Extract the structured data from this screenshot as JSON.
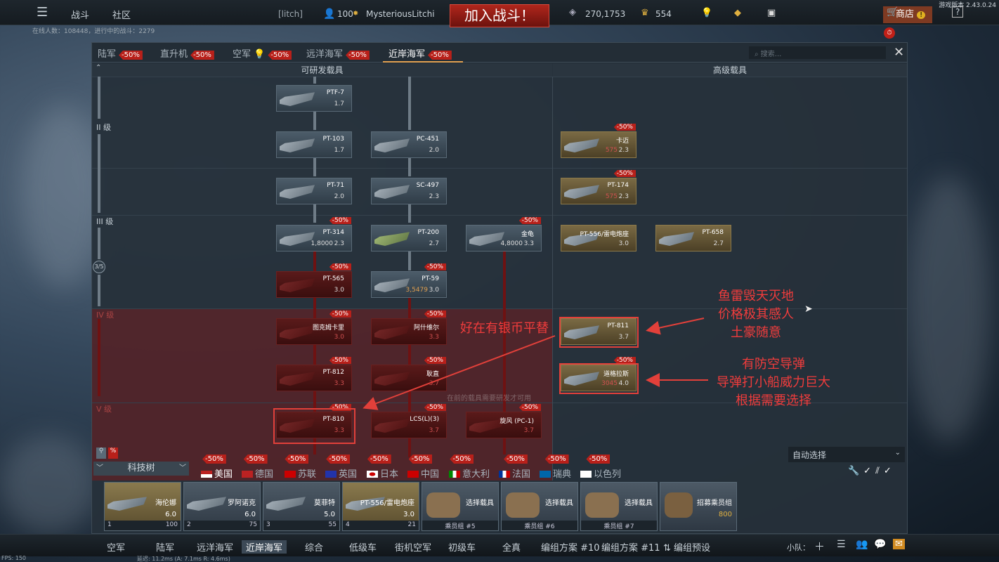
{
  "top": {
    "battles": "战斗",
    "community": "社区",
    "clan_tag": "[litch]",
    "level": "100",
    "username": "MysteriousLitchi",
    "join_battle": "加入战斗！",
    "silver": "270,1753",
    "gold": "554",
    "shop": "商店",
    "version": "游戏版本 2.43.0.24",
    "online": "在线人数：108448，进行中的战斗：2279"
  },
  "tabs": [
    {
      "label": "陆军",
      "disc": "-50%"
    },
    {
      "label": "直升机",
      "disc": "-50%"
    },
    {
      "label": "空军",
      "disc": "-50%"
    },
    {
      "label": "远洋海军",
      "disc": "-50%"
    },
    {
      "label": "近岸海军",
      "disc": "-50%"
    }
  ],
  "search_placeholder": "搜索...",
  "col_research": "可研发载具",
  "col_premium": "高级载具",
  "ranks": {
    "r2": "II 级",
    "r3": "III 级",
    "r4": "IV 级",
    "r5": "V 级",
    "progress": "3/5"
  },
  "cards": {
    "ptf7": {
      "name": "PTF-7",
      "br": "1.7"
    },
    "pt103": {
      "name": "PT-103",
      "br": "1.7"
    },
    "pc451": {
      "name": "PC-451",
      "br": "2.0"
    },
    "kamai": {
      "name": "卡迈",
      "br": "2.3",
      "gold": "575",
      "disc": "-50%"
    },
    "pt71": {
      "name": "PT-71",
      "br": "2.0"
    },
    "sc497": {
      "name": "SC-497",
      "br": "2.3"
    },
    "pt174": {
      "name": "PT-174",
      "br": "2.3",
      "gold": "575",
      "disc": "-50%"
    },
    "pt314": {
      "name": "PT-314",
      "br": "2.3",
      "cost": "1,8000",
      "disc": "-50%"
    },
    "pt200": {
      "name": "PT-200",
      "br": "2.7"
    },
    "jingui": {
      "name": "金龟",
      "br": "3.3",
      "cost": "4,8000",
      "disc": "-50%"
    },
    "pt556": {
      "name": "PT-556/雷电炮座",
      "br": "3.0"
    },
    "pt658": {
      "name": "PT-658",
      "br": "2.7"
    },
    "pt565": {
      "name": "PT-565",
      "br": "3.0",
      "disc": "-50%"
    },
    "pt59": {
      "name": "PT-59",
      "br": "3.0",
      "cost": "3,5479",
      "disc": "-50%"
    },
    "tukm": {
      "name": "图克姆卡里",
      "br": "3.0",
      "disc": "-50%"
    },
    "ashv": {
      "name": "阿什维尔",
      "br": "3.3",
      "disc": "-50%"
    },
    "pt811": {
      "name": "PT-811",
      "br": "3.7"
    },
    "pt812": {
      "name": "PT-812",
      "br": "3.3",
      "disc": "-50%"
    },
    "genzhi": {
      "name": "耿直",
      "br": "3.7",
      "disc": "-50%"
    },
    "douglas": {
      "name": "道格拉斯",
      "br": "4.0",
      "gold": "3045",
      "disc": "-50%"
    },
    "pt810": {
      "name": "PT-810",
      "br": "3.3",
      "disc": "-50%"
    },
    "lcs": {
      "name": "LCS(L)(3)",
      "br": "3.7",
      "disc": "-50%"
    },
    "xuanfeng": {
      "name": "旋风 (PC-1)",
      "br": "3.7",
      "disc": "-50%"
    }
  },
  "annotations": {
    "a1": "鱼雷毁天灭地\n价格极其感人\n土豪随意",
    "a2": "好在有银币平替",
    "a3": "有防空导弹\n导弹打小船威力巨大\n根据需要选择"
  },
  "ghost_text": "在前的载具需要研发才可用",
  "techtree": "科技树",
  "auto_select": "自动选择",
  "nations": [
    "美国",
    "德国",
    "苏联",
    "英国",
    "日本",
    "中国",
    "意大利",
    "法国",
    "瑞典",
    "以色列"
  ],
  "nation_disc": "-50%",
  "crews": [
    {
      "name": "海伦娜",
      "br": "6.0",
      "foot_l": "1",
      "foot_r": "100"
    },
    {
      "name": "罗阿诺克",
      "br": "6.0",
      "foot_l": "2",
      "foot_r": "75"
    },
    {
      "name": "莫菲特",
      "br": "5.0",
      "foot_l": "3",
      "foot_r": "55"
    },
    {
      "name": "PT-556/雷电炮座",
      "br": "3.0",
      "foot_l": "4",
      "foot_r": "21"
    },
    {
      "name": "选择载具",
      "br": "",
      "foot_l": "乘员组 #5",
      "foot_r": ""
    },
    {
      "name": "选择载具",
      "br": "",
      "foot_l": "乘员组 #6",
      "foot_r": ""
    },
    {
      "name": "选择载具",
      "br": "",
      "foot_l": "乘员组 #7",
      "foot_r": ""
    },
    {
      "name": "招募乘员组",
      "br": "800",
      "foot_l": "",
      "foot_r": ""
    }
  ],
  "bottom": [
    "空军",
    "陆军",
    "远洋海军",
    "近岸海军",
    "综合",
    "低级车",
    "街机空军",
    "初级车",
    "全真",
    "编组方案 #10",
    "编组方案 #11",
    "编组预设"
  ],
  "squad": "小队：",
  "fps": "FPS: 150",
  "latency": "延迟: 11.2ms (A:  7.1ms R:  4.6ms)",
  "colors": {
    "accent": "#e2403a",
    "discount": "#b8201a",
    "gold": "#e0b040"
  }
}
